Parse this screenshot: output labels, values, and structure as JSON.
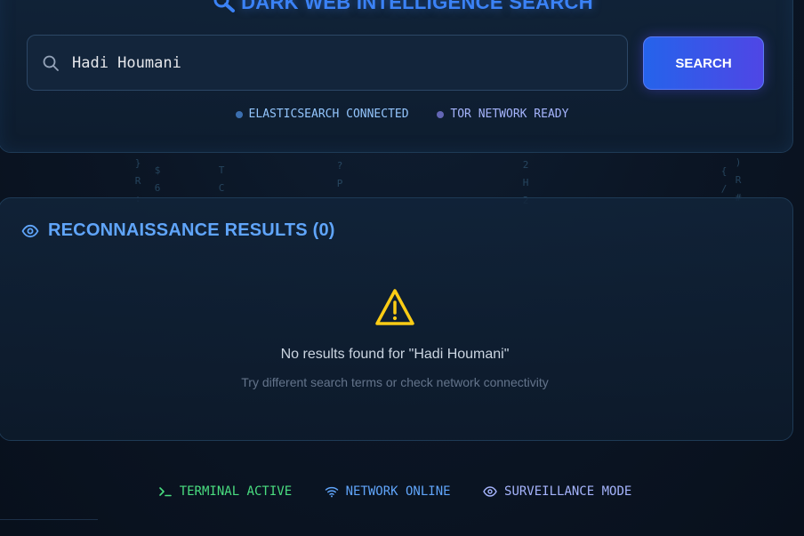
{
  "header": {
    "title": "DARK WEB INTELLIGENCE SEARCH",
    "title_icon": "magnifier-icon"
  },
  "search": {
    "value": "Hadi Houmani",
    "placeholder": "",
    "button_label": "SEARCH"
  },
  "status": {
    "elasticsearch": "ELASTICSEARCH CONNECTED",
    "tor": "TOR NETWORK READY"
  },
  "results": {
    "title": "RECONNAISSANCE RESULTS (0)",
    "empty_message": "No results found for \"Hadi Houmani\"",
    "hint": "Try different search terms or check network connectivity"
  },
  "footer": {
    "terminal": "TERMINAL ACTIVE",
    "network": "NETWORK ONLINE",
    "surveillance": "SURVEILLANCE MODE"
  },
  "colors": {
    "accent_blue": "#3b82f6",
    "button_start": "#2563eb",
    "button_end": "#4f46e5",
    "terminal_green": "#4ade80",
    "warning_yellow": "#facc15"
  },
  "background_glyphs": [
    {
      "id": "c1",
      "chars": "}R:"
    },
    {
      "id": "c2",
      "chars": "$6"
    },
    {
      "id": "c3",
      "chars": "TC"
    },
    {
      "id": "c4",
      "chars": "?P"
    },
    {
      "id": "c5",
      "chars": "2H2"
    },
    {
      "id": "c6",
      "chars": "{/"
    },
    {
      "id": "c7",
      "chars": ")R#"
    }
  ]
}
